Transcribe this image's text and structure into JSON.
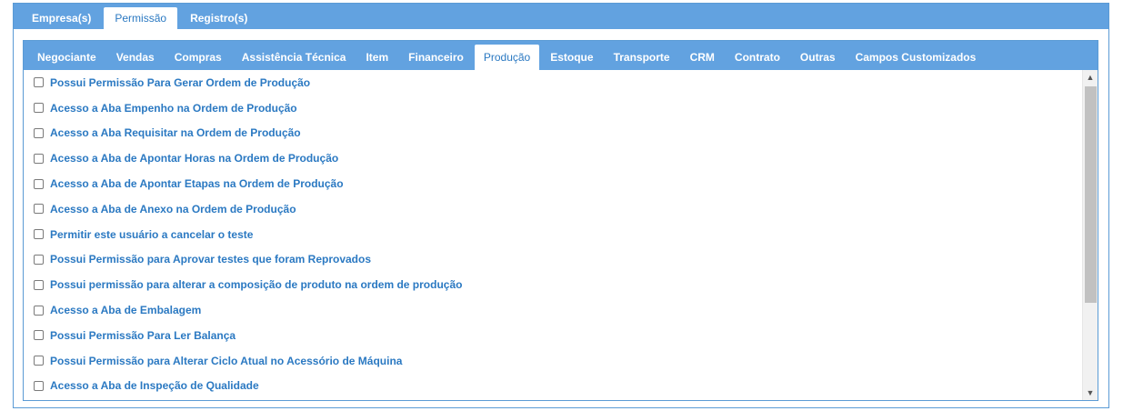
{
  "top_tabs": [
    {
      "label": "Empresa(s)"
    },
    {
      "label": "Permissão"
    },
    {
      "label": "Registro(s)"
    }
  ],
  "sub_tabs": [
    {
      "label": "Negociante"
    },
    {
      "label": "Vendas"
    },
    {
      "label": "Compras"
    },
    {
      "label": "Assistência Técnica"
    },
    {
      "label": "Item"
    },
    {
      "label": "Financeiro"
    },
    {
      "label": "Produção"
    },
    {
      "label": "Estoque"
    },
    {
      "label": "Transporte"
    },
    {
      "label": "CRM"
    },
    {
      "label": "Contrato"
    },
    {
      "label": "Outras"
    },
    {
      "label": "Campos Customizados"
    }
  ],
  "permissions": [
    {
      "label": "Possui Permissão Para Gerar Ordem de Produção"
    },
    {
      "label": "Acesso a Aba Empenho na Ordem de Produção"
    },
    {
      "label": "Acesso a Aba Requisitar na Ordem de Produção"
    },
    {
      "label": "Acesso a Aba de Apontar Horas na Ordem de Produção"
    },
    {
      "label": "Acesso a Aba de Apontar Etapas na Ordem de Produção"
    },
    {
      "label": "Acesso a Aba de Anexo na Ordem de Produção"
    },
    {
      "label": "Permitir este usuário a cancelar o teste"
    },
    {
      "label": "Possui Permissão para Aprovar testes que foram Reprovados"
    },
    {
      "label": "Possui permissão para alterar a composição de produto na ordem de produção"
    },
    {
      "label": "Acesso a Aba de Embalagem"
    },
    {
      "label": "Possui Permissão Para Ler Balança"
    },
    {
      "label": "Possui Permissão para Alterar Ciclo Atual no Acessório de Máquina"
    },
    {
      "label": "Acesso a Aba de Inspeção de Qualidade"
    }
  ],
  "colors": {
    "accent": "#62a2e0",
    "link": "#2b79c2",
    "border": "#5b9bd5"
  },
  "icons": {
    "scroll_up": "chevron-up-icon",
    "scroll_down": "chevron-down-icon"
  }
}
